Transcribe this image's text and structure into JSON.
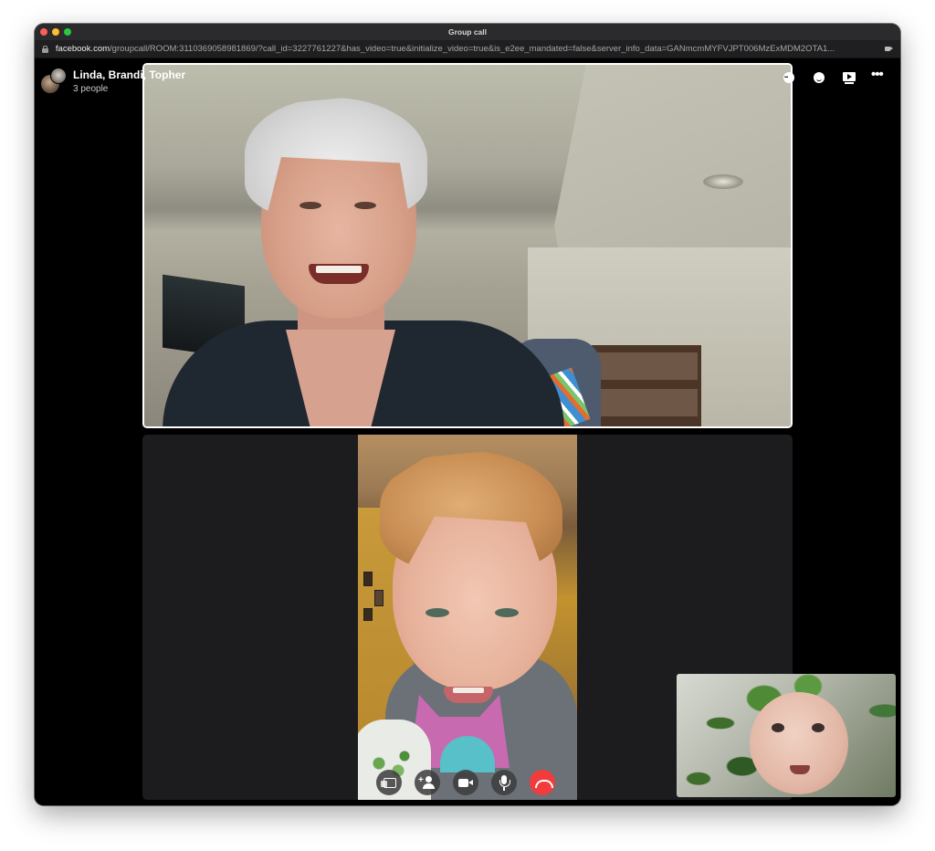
{
  "window": {
    "title": "Group call"
  },
  "address_bar": {
    "domain": "facebook.com",
    "path": "/groupcall/ROOM:3110369058981869/?call_id=3227761227&has_video=true&initialize_video=true&is_e2ee_mandated=false&server_info_data=GANmcmMYFVJPT006MzExMDM2OTA1..."
  },
  "call": {
    "participants": "Linda, Brandi, Topher",
    "people_count": "3 people"
  },
  "top_actions": [
    {
      "name": "more-options-circle-icon"
    },
    {
      "name": "emoji-reaction-icon"
    },
    {
      "name": "watch-together-icon"
    },
    {
      "name": "ellipsis-menu-icon"
    }
  ],
  "controls": [
    {
      "name": "share-screen-icon"
    },
    {
      "name": "add-person-icon"
    },
    {
      "name": "video-camera-icon"
    },
    {
      "name": "microphone-icon"
    },
    {
      "name": "end-call-icon"
    }
  ],
  "colors": {
    "end_call": "#f23c3c",
    "tile_active_border": "#ffffff",
    "background": "#000000"
  }
}
